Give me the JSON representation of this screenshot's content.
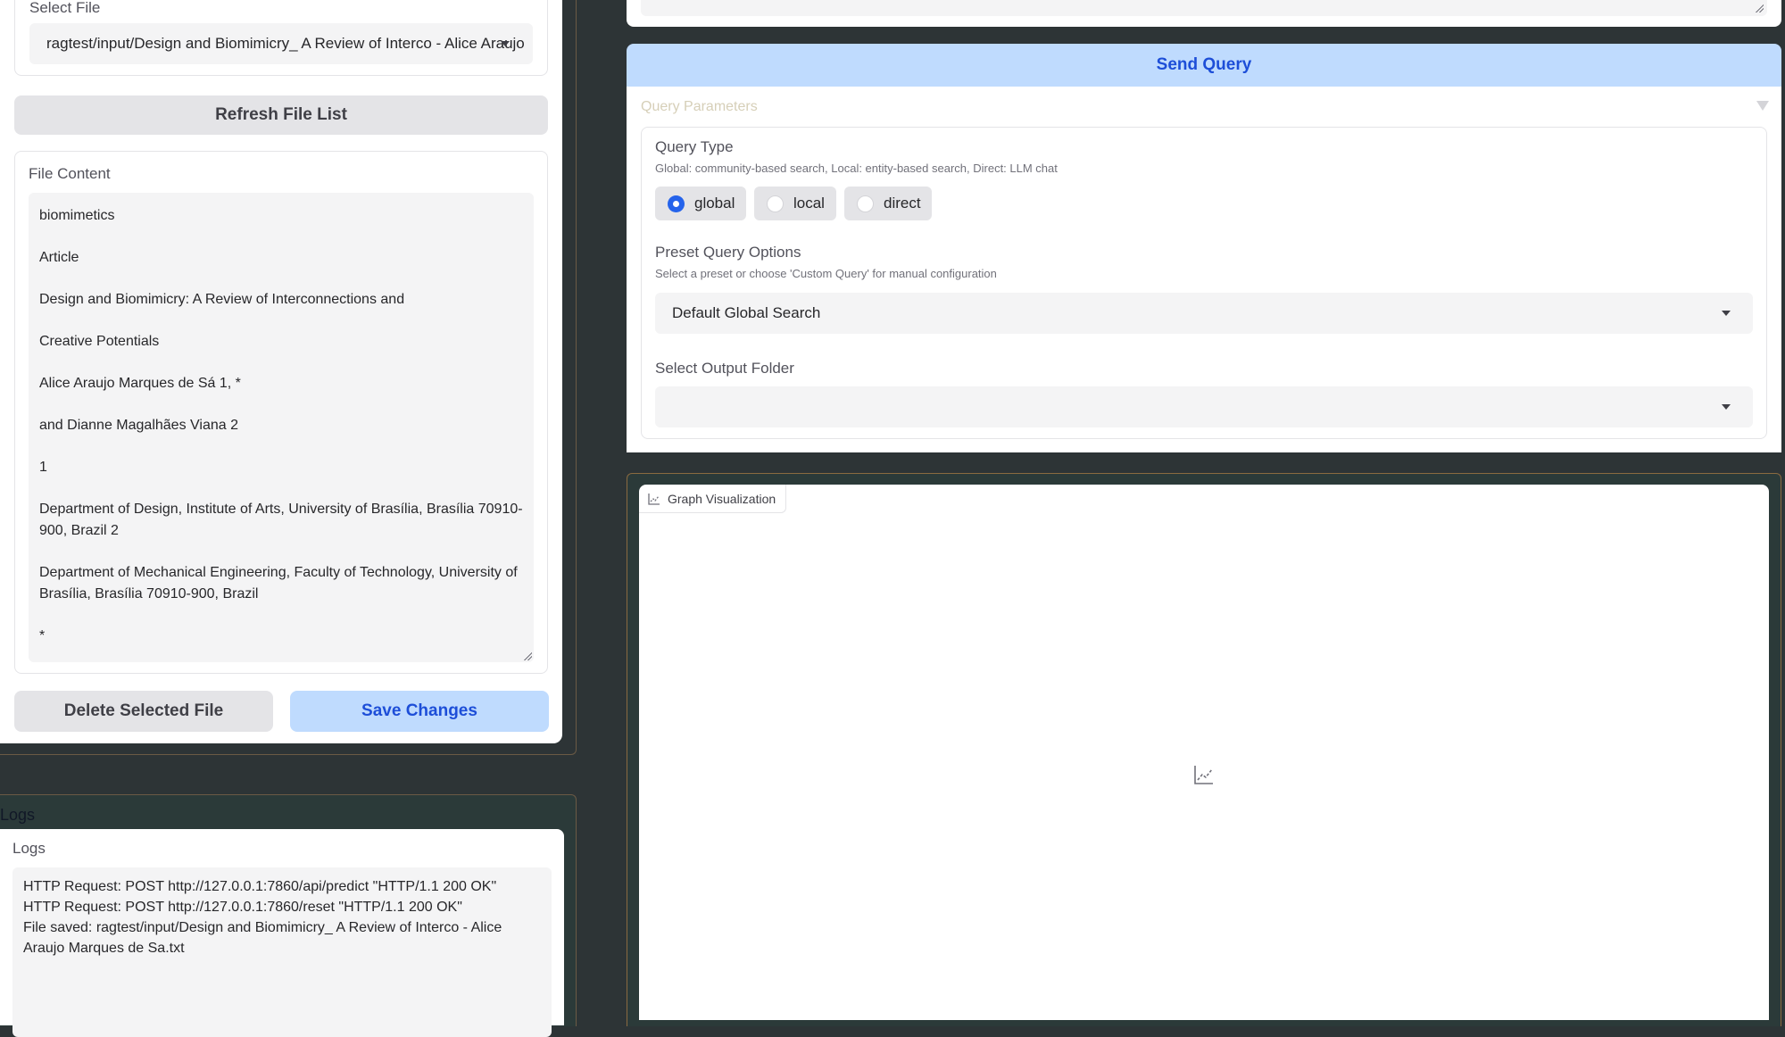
{
  "file_manager": {
    "select_label": "Select File",
    "selected_file": "ragtest/input/Design and Biomimicry_ A Review of Interco - Alice Araujo",
    "refresh_label": "Refresh File List",
    "content_label": "File Content",
    "content_lines": [
      "biomimetics",
      "Article",
      "Design and Biomimicry: A Review of Interconnections and",
      "Creative Potentials",
      "Alice Araujo Marques de Sá 1, *",
      "and Dianne Magalhães Viana 2",
      "1",
      "Department of Design, Institute of Arts, University of Brasília, Brasília 70910-900, Brazil 2",
      "Department of Mechanical Engineering, Faculty of Technology, University of Brasília, Brasília 70910-900, Brazil",
      "*"
    ],
    "delete_label": "Delete Selected File",
    "save_label": "Save Changes"
  },
  "logs": {
    "heading": "Logs",
    "label": "Logs",
    "lines": [
      "HTTP Request: POST http://127.0.0.1:7860/api/predict \"HTTP/1.1 200 OK\"",
      "HTTP Request: POST http://127.0.0.1:7860/reset \"HTTP/1.1 200 OK\"",
      "File saved: ragtest/input/Design and Biomimicry_ A Review of Interco - Alice Araujo Marques de Sa.txt"
    ]
  },
  "query": {
    "send_label": "Send Query",
    "params_title": "Query Parameters",
    "type_label": "Query Type",
    "type_info": "Global: community-based search, Local: entity-based search, Direct: LLM chat",
    "type_options": [
      "global",
      "local",
      "direct"
    ],
    "type_selected": "global",
    "preset_label": "Preset Query Options",
    "preset_info": "Select a preset or choose 'Custom Query' for manual configuration",
    "preset_value": "Default Global Search",
    "output_label": "Select Output Folder",
    "output_value": ""
  },
  "graph": {
    "tab_label": "Graph Visualization"
  },
  "colors": {
    "primary_button_bg": "#bfdbfe",
    "primary_button_text": "#1d4ed8",
    "radio_checked": "#2563eb",
    "page_bg": "#2d3436"
  }
}
